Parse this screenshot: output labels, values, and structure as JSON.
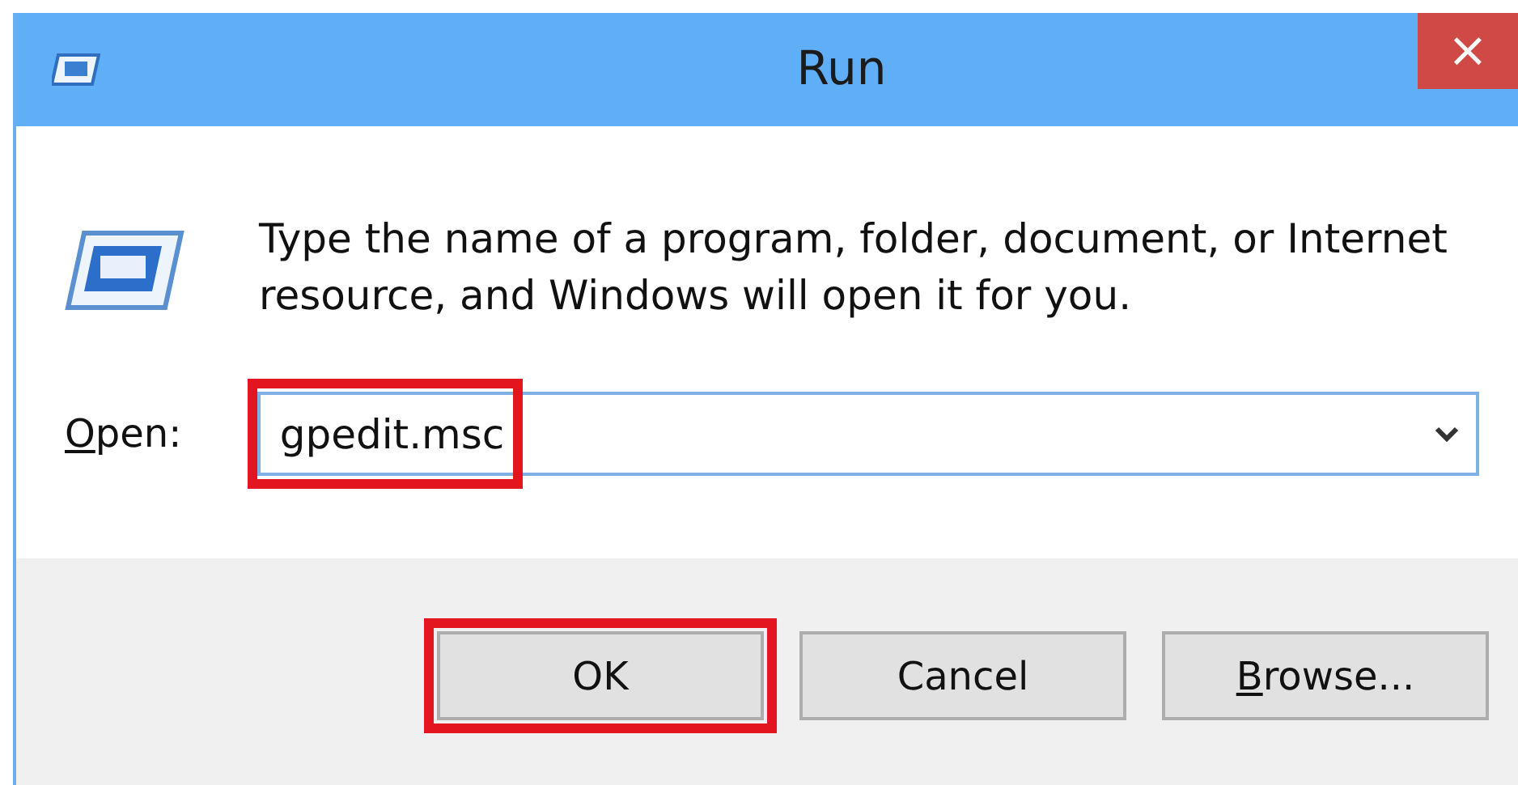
{
  "window": {
    "title": "Run",
    "close": "×"
  },
  "message": "Type the name of a program, folder, document, or Internet resource, and Windows will open it for you.",
  "open_field": {
    "label": {
      "key": "O",
      "rest": "pen:"
    },
    "value": "gpedit.msc",
    "highlighted": true
  },
  "buttons": [
    {
      "text": "OK",
      "highlighted": true
    },
    {
      "text": "Cancel",
      "highlighted": false
    },
    {
      "key": "B",
      "text": "rowse...",
      "highlighted": false
    }
  ]
}
